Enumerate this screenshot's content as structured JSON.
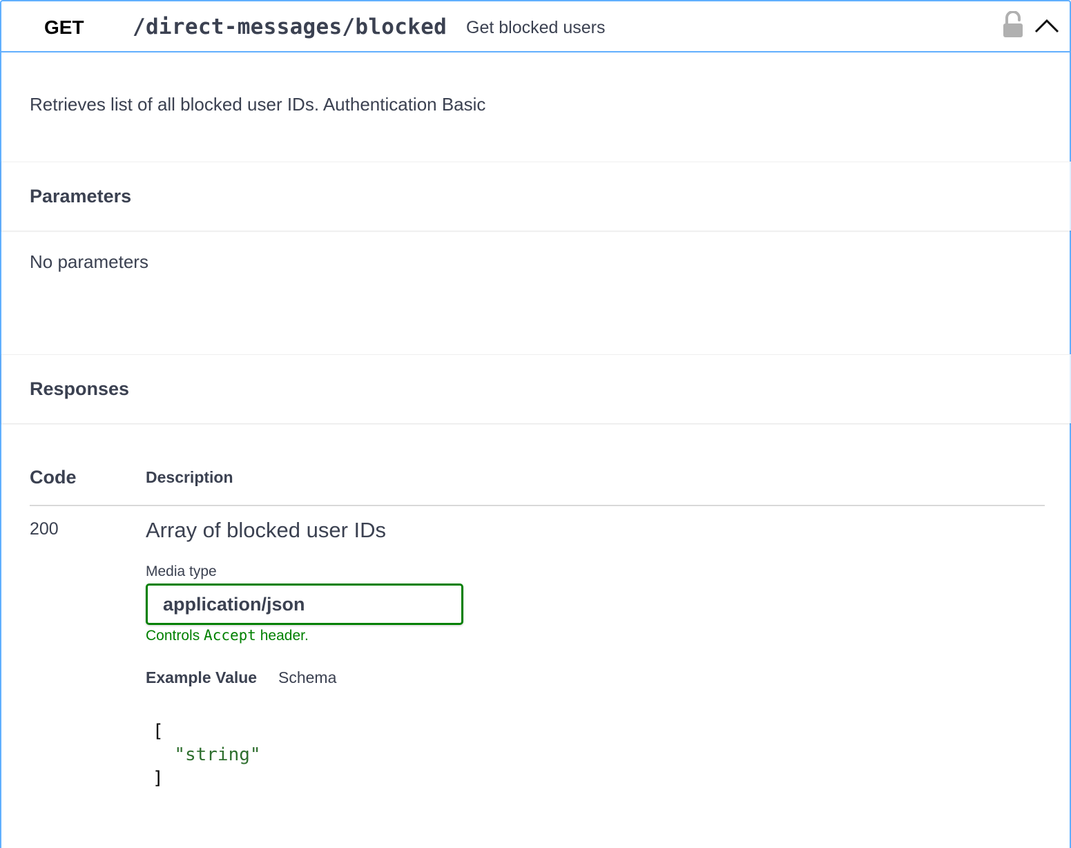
{
  "operation": {
    "method": "GET",
    "path": "/direct-messages/blocked",
    "summary": "Get blocked users",
    "description": "Retrieves list of all blocked user IDs. Authentication Basic",
    "colors": {
      "accent": "#61affe",
      "media_border": "#008000"
    },
    "icons": {
      "lock": "lock-open-icon",
      "collapse": "chevron-up-icon"
    }
  },
  "parameters": {
    "title": "Parameters",
    "empty_text": "No parameters"
  },
  "responses": {
    "title": "Responses",
    "columns": {
      "code": "Code",
      "description": "Description"
    },
    "rows": [
      {
        "code": "200",
        "description": "Array of blocked user IDs",
        "media_type_label": "Media type",
        "media_type_value": "application/json",
        "controls_prefix": "Controls",
        "controls_code": "Accept",
        "controls_suffix": "header.",
        "tabs": [
          "Example Value",
          "Schema"
        ],
        "example": {
          "open": "[",
          "item": "\"string\"",
          "close": "]"
        }
      }
    ]
  }
}
